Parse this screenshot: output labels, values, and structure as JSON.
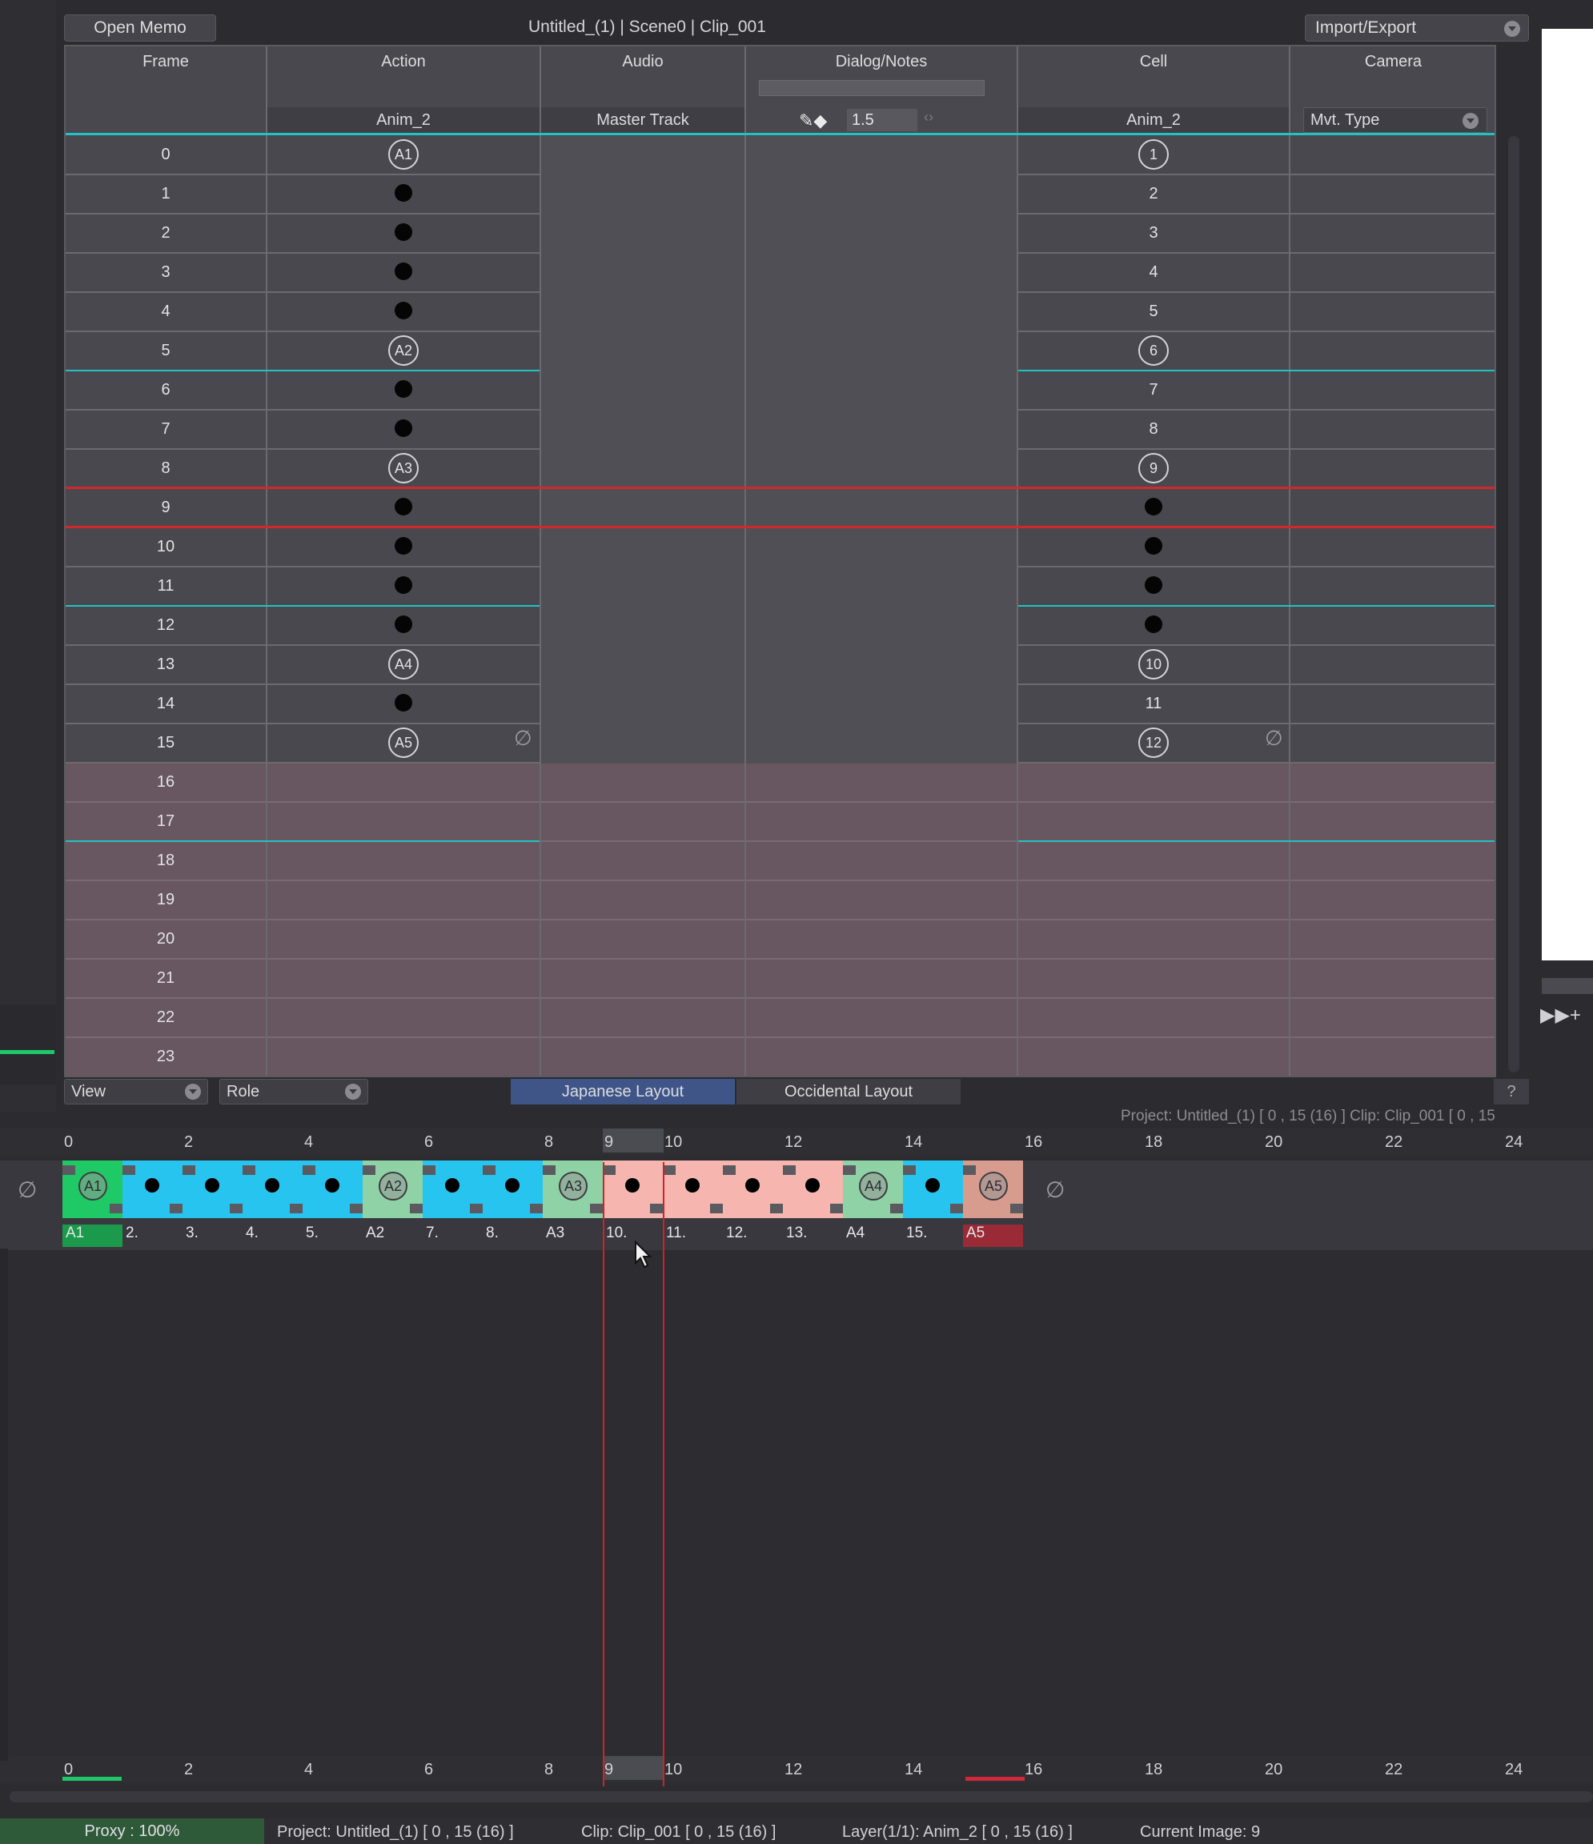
{
  "top": {
    "open_memo": "Open Memo",
    "title": "Untitled_(1) | Scene0 | Clip_001",
    "import_export": "Import/Export"
  },
  "columns": {
    "frame": "Frame",
    "action": "Action",
    "action_sub": "Anim_2",
    "audio": "Audio",
    "audio_sub": "Master Track",
    "dialog": "Dialog/Notes",
    "dialog_value": "1.5",
    "cell": "Cell",
    "cell_sub": "Anim_2",
    "camera": "Camera",
    "camera_sub": "Mvt. Type"
  },
  "sheet_rows": [
    {
      "frame": "0",
      "action": "A1",
      "action_type": "key",
      "cell": "1",
      "cell_type": "key"
    },
    {
      "frame": "1",
      "action": "",
      "action_type": "dot",
      "cell": "2",
      "cell_type": "num"
    },
    {
      "frame": "2",
      "action": "",
      "action_type": "dot",
      "cell": "3",
      "cell_type": "num"
    },
    {
      "frame": "3",
      "action": "",
      "action_type": "dot",
      "cell": "4",
      "cell_type": "num"
    },
    {
      "frame": "4",
      "action": "",
      "action_type": "dot",
      "cell": "5",
      "cell_type": "num"
    },
    {
      "frame": "5",
      "action": "A2",
      "action_type": "key",
      "cell": "6",
      "cell_type": "key"
    },
    {
      "frame": "6",
      "action": "",
      "action_type": "dot",
      "cell": "7",
      "cell_type": "num"
    },
    {
      "frame": "7",
      "action": "",
      "action_type": "dot",
      "cell": "8",
      "cell_type": "num"
    },
    {
      "frame": "8",
      "action": "A3",
      "action_type": "key",
      "cell": "9",
      "cell_type": "key"
    },
    {
      "frame": "9",
      "action": "",
      "action_type": "dot",
      "cell": "",
      "cell_type": "dot"
    },
    {
      "frame": "10",
      "action": "",
      "action_type": "dot",
      "cell": "",
      "cell_type": "dot"
    },
    {
      "frame": "11",
      "action": "",
      "action_type": "dot",
      "cell": "",
      "cell_type": "dot"
    },
    {
      "frame": "12",
      "action": "",
      "action_type": "dot",
      "cell": "",
      "cell_type": "dot"
    },
    {
      "frame": "13",
      "action": "A4",
      "action_type": "key",
      "cell": "10",
      "cell_type": "key"
    },
    {
      "frame": "14",
      "action": "",
      "action_type": "dot",
      "cell": "11",
      "cell_type": "num"
    },
    {
      "frame": "15",
      "action": "A5",
      "action_type": "key",
      "cell": "12",
      "cell_type": "key"
    },
    {
      "frame": "16",
      "action": "",
      "action_type": "",
      "cell": "",
      "cell_type": ""
    },
    {
      "frame": "17",
      "action": "",
      "action_type": "",
      "cell": "",
      "cell_type": ""
    },
    {
      "frame": "18",
      "action": "",
      "action_type": "",
      "cell": "",
      "cell_type": ""
    },
    {
      "frame": "19",
      "action": "",
      "action_type": "",
      "cell": "",
      "cell_type": ""
    },
    {
      "frame": "20",
      "action": "",
      "action_type": "",
      "cell": "",
      "cell_type": ""
    },
    {
      "frame": "21",
      "action": "",
      "action_type": "",
      "cell": "",
      "cell_type": ""
    },
    {
      "frame": "22",
      "action": "",
      "action_type": "",
      "cell": "",
      "cell_type": ""
    },
    {
      "frame": "23",
      "action": "",
      "action_type": "",
      "cell": "",
      "cell_type": ""
    }
  ],
  "clip_last_frame": 15,
  "current_frame": 9,
  "sheet_bottom": {
    "view": "View",
    "role": "Role",
    "japanese_layout": "Japanese Layout",
    "occidental_layout": "Occidental Layout",
    "help": "?"
  },
  "info_line": "Project: Untitled_(1) [ 0 , 15  (16) ]        Clip: Clip_001 [ 0 , 15",
  "ruler_ticks": [
    "0",
    "2",
    "4",
    "6",
    "8",
    "9",
    "10",
    "12",
    "14",
    "16",
    "18",
    "20",
    "22",
    "24"
  ],
  "timeline_frames": [
    {
      "label": "A1",
      "type": "key",
      "key": "A1",
      "color": "#1fc965"
    },
    {
      "label": "2.",
      "type": "dot",
      "key": "",
      "color": "#27c4ef"
    },
    {
      "label": "3.",
      "type": "dot",
      "key": "",
      "color": "#27c4ef"
    },
    {
      "label": "4.",
      "type": "dot",
      "key": "",
      "color": "#27c4ef"
    },
    {
      "label": "5.",
      "type": "dot",
      "key": "",
      "color": "#27c4ef"
    },
    {
      "label": "A2",
      "type": "key",
      "key": "A2",
      "color": "#8fd2a6"
    },
    {
      "label": "7.",
      "type": "dot",
      "key": "",
      "color": "#27c4ef"
    },
    {
      "label": "8.",
      "type": "dot",
      "key": "",
      "color": "#27c4ef"
    },
    {
      "label": "A3",
      "type": "key",
      "key": "A3",
      "color": "#8fd2a6"
    },
    {
      "label": "10.",
      "type": "dot",
      "key": "",
      "color": "#f6b5ae"
    },
    {
      "label": "11.",
      "type": "dot",
      "key": "",
      "color": "#f6b5ae"
    },
    {
      "label": "12.",
      "type": "dot",
      "key": "",
      "color": "#f6b5ae"
    },
    {
      "label": "13.",
      "type": "dot",
      "key": "",
      "color": "#f6b5ae"
    },
    {
      "label": "A4",
      "type": "key",
      "key": "A4",
      "color": "#8fd2a6"
    },
    {
      "label": "15.",
      "type": "dot",
      "key": "",
      "color": "#27c4ef"
    },
    {
      "label": "A5",
      "type": "key",
      "key": "A5",
      "color": "#d89c8e"
    }
  ],
  "status": {
    "proxy": "Proxy : 100%",
    "project": "Project: Untitled_(1) [ 0 , 15  (16) ]",
    "clip": "Clip: Clip_001 [ 0 , 15  (16) ]",
    "layer": "Layer(1/1): Anim_2 [ 0 , 15  (16) ]",
    "current_image": "Current Image: 9"
  },
  "colors": {
    "accent_cyan": "#23c2c2",
    "playhead_red": "#d2282c",
    "past_range": "#685761",
    "start_green": "#1ec86a"
  },
  "icons": {
    "null": "empty-set-icon",
    "chevron": "chevron-down-icon",
    "fast_forward": "fast-forward-add-icon",
    "pointer": "mouse-pointer-icon"
  }
}
